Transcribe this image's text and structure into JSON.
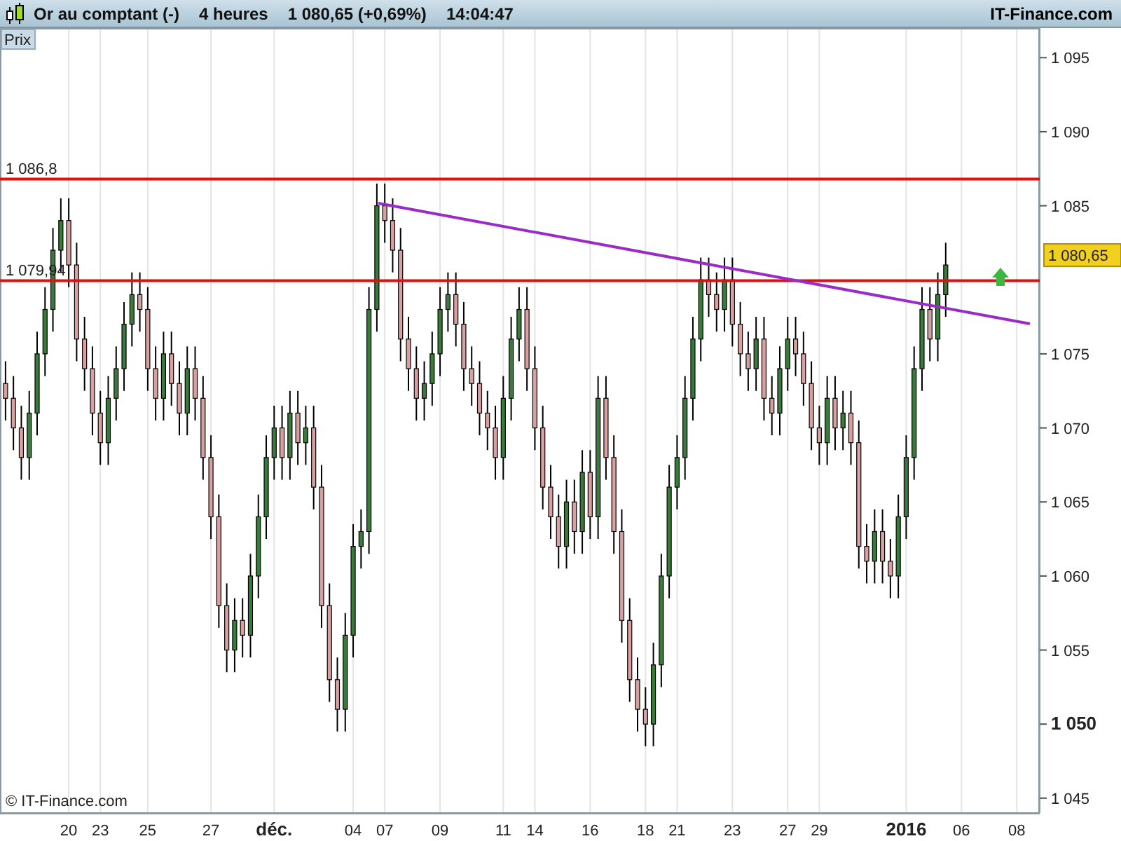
{
  "header": {
    "instrument": "Or au comptant (-)",
    "period": "4 heures",
    "quote": "1 080,65 (+0,69%)",
    "time": "14:04:47",
    "brand": "IT-Finance.com"
  },
  "panel_label": "Prix",
  "copyright": "© IT-Finance.com",
  "trend_line": {
    "color": "#9a2bc8"
  },
  "signal": {
    "kind": "up",
    "color": "#3cb83c"
  },
  "last_price": {
    "label": "1 080,65",
    "color": "#f2d020"
  },
  "chart_data": {
    "type": "candlestick",
    "ylim": [
      1044,
      1097
    ],
    "yticks": [
      {
        "value": 1045,
        "label": "1 045"
      },
      {
        "value": 1050,
        "label": "1 050"
      },
      {
        "value": 1055,
        "label": "1 055"
      },
      {
        "value": 1060,
        "label": "1 060"
      },
      {
        "value": 1065,
        "label": "1 065"
      },
      {
        "value": 1070,
        "label": "1 070"
      },
      {
        "value": 1075,
        "label": "1 075"
      },
      {
        "value": 1085,
        "label": "1 085"
      },
      {
        "value": 1090,
        "label": "1 090"
      },
      {
        "value": 1095,
        "label": "1 095"
      }
    ],
    "categories": [
      null,
      null,
      null,
      null,
      null,
      null,
      null,
      null,
      "20",
      null,
      null,
      null,
      "23",
      null,
      null,
      null,
      null,
      null,
      "25",
      null,
      null,
      null,
      null,
      null,
      null,
      null,
      "27",
      null,
      null,
      null,
      null,
      null,
      null,
      null,
      "déc.",
      null,
      null,
      null,
      null,
      null,
      null,
      null,
      null,
      null,
      "04",
      null,
      null,
      null,
      "07",
      null,
      null,
      null,
      null,
      null,
      null,
      "09",
      null,
      null,
      null,
      null,
      null,
      null,
      null,
      "11",
      null,
      null,
      null,
      "14",
      null,
      null,
      null,
      null,
      null,
      null,
      "16",
      null,
      null,
      null,
      null,
      null,
      null,
      "18",
      null,
      null,
      null,
      "21",
      null,
      null,
      null,
      null,
      null,
      null,
      "23",
      null,
      null,
      null,
      null,
      null,
      null,
      "27",
      null,
      null,
      null,
      "29",
      null,
      null,
      null,
      null,
      null,
      null,
      null,
      null,
      null,
      null,
      "2016",
      null,
      null,
      null,
      null,
      null,
      null,
      "06",
      null,
      null,
      null,
      null,
      null,
      null,
      "08",
      null,
      null
    ],
    "ref_lines": [
      {
        "axis": "y",
        "value": 1086.8,
        "label": "1 086,8",
        "color": "#e01010"
      },
      {
        "axis": "y",
        "value": 1079.94,
        "label": "1 079,94",
        "color": "#e01010"
      }
    ],
    "ohlc": [
      [
        1073,
        1074.5,
        1070.5,
        1072
      ],
      [
        1072,
        1073.5,
        1068.5,
        1070
      ],
      [
        1070,
        1071.5,
        1066.5,
        1068
      ],
      [
        1068,
        1072.5,
        1066.5,
        1071
      ],
      [
        1071,
        1076.5,
        1069.5,
        1075
      ],
      [
        1075,
        1079.5,
        1073.5,
        1078
      ],
      [
        1078,
        1083.5,
        1076.5,
        1082
      ],
      [
        1082,
        1085.5,
        1080.5,
        1084
      ],
      [
        1084,
        1085.5,
        1079.5,
        1081
      ],
      [
        1081,
        1082.5,
        1074.5,
        1076
      ],
      [
        1076,
        1077.5,
        1072.5,
        1074
      ],
      [
        1074,
        1075.5,
        1069.5,
        1071
      ],
      [
        1071,
        1072.5,
        1067.5,
        1069
      ],
      [
        1069,
        1073.5,
        1067.5,
        1072
      ],
      [
        1072,
        1075.5,
        1070.5,
        1074
      ],
      [
        1074,
        1078.5,
        1072.5,
        1077
      ],
      [
        1077,
        1080.5,
        1075.5,
        1079
      ],
      [
        1079,
        1080.5,
        1076.5,
        1078
      ],
      [
        1078,
        1079.5,
        1072.5,
        1074
      ],
      [
        1074,
        1075.5,
        1070.5,
        1072
      ],
      [
        1072,
        1076.5,
        1070.5,
        1075
      ],
      [
        1075,
        1076.5,
        1071.5,
        1073
      ],
      [
        1073,
        1074.5,
        1069.5,
        1071
      ],
      [
        1071,
        1075.5,
        1069.5,
        1074
      ],
      [
        1074,
        1075.5,
        1070.5,
        1072
      ],
      [
        1072,
        1073.5,
        1066.5,
        1068
      ],
      [
        1068,
        1069.5,
        1062.5,
        1064
      ],
      [
        1064,
        1065.5,
        1056.5,
        1058
      ],
      [
        1058,
        1059.5,
        1053.5,
        1055
      ],
      [
        1055,
        1058.5,
        1053.5,
        1057
      ],
      [
        1057,
        1058.5,
        1054.5,
        1056
      ],
      [
        1056,
        1061.5,
        1054.5,
        1060
      ],
      [
        1060,
        1065.5,
        1058.5,
        1064
      ],
      [
        1064,
        1069.5,
        1062.5,
        1068
      ],
      [
        1068,
        1071.5,
        1066.5,
        1070
      ],
      [
        1070,
        1071.5,
        1066.5,
        1068
      ],
      [
        1068,
        1072.5,
        1066.5,
        1071
      ],
      [
        1071,
        1072.5,
        1067.5,
        1069
      ],
      [
        1069,
        1071.5,
        1067.5,
        1070
      ],
      [
        1070,
        1071.5,
        1064.5,
        1066
      ],
      [
        1066,
        1067.5,
        1056.5,
        1058
      ],
      [
        1058,
        1059.5,
        1051.5,
        1053
      ],
      [
        1053,
        1054.5,
        1049.5,
        1051
      ],
      [
        1051,
        1057.5,
        1049.5,
        1056
      ],
      [
        1056,
        1063.5,
        1054.5,
        1062
      ],
      [
        1062,
        1064.5,
        1060.5,
        1063
      ],
      [
        1063,
        1079.5,
        1061.5,
        1078
      ],
      [
        1078,
        1086.5,
        1076.5,
        1085
      ],
      [
        1085,
        1086.5,
        1082.5,
        1084
      ],
      [
        1084,
        1085.5,
        1080.5,
        1082
      ],
      [
        1082,
        1083.5,
        1074.5,
        1076
      ],
      [
        1076,
        1077.5,
        1072.5,
        1074
      ],
      [
        1074,
        1075.5,
        1070.5,
        1072
      ],
      [
        1072,
        1074.5,
        1070.5,
        1073
      ],
      [
        1073,
        1076.5,
        1071.5,
        1075
      ],
      [
        1075,
        1079.5,
        1073.5,
        1078
      ],
      [
        1078,
        1080.5,
        1076.5,
        1079
      ],
      [
        1079,
        1080.5,
        1075.5,
        1077
      ],
      [
        1077,
        1078.5,
        1072.5,
        1074
      ],
      [
        1074,
        1075.5,
        1071.5,
        1073
      ],
      [
        1073,
        1074.5,
        1069.5,
        1071
      ],
      [
        1071,
        1072.5,
        1068.5,
        1070
      ],
      [
        1070,
        1071.5,
        1066.5,
        1068
      ],
      [
        1068,
        1073.5,
        1066.5,
        1072
      ],
      [
        1072,
        1077.5,
        1070.5,
        1076
      ],
      [
        1076,
        1079.5,
        1074.5,
        1078
      ],
      [
        1078,
        1079.5,
        1072.5,
        1074
      ],
      [
        1074,
        1075.5,
        1068.5,
        1070
      ],
      [
        1070,
        1071.5,
        1064.5,
        1066
      ],
      [
        1066,
        1067.5,
        1062.5,
        1064
      ],
      [
        1064,
        1065.5,
        1060.5,
        1062
      ],
      [
        1062,
        1066.5,
        1060.5,
        1065
      ],
      [
        1065,
        1066.5,
        1061.5,
        1063
      ],
      [
        1063,
        1068.5,
        1061.5,
        1067
      ],
      [
        1067,
        1068.5,
        1062.5,
        1064
      ],
      [
        1064,
        1073.5,
        1062.5,
        1072
      ],
      [
        1072,
        1073.5,
        1066.5,
        1068
      ],
      [
        1068,
        1069.5,
        1061.5,
        1063
      ],
      [
        1063,
        1064.5,
        1055.5,
        1057
      ],
      [
        1057,
        1058.5,
        1051.5,
        1053
      ],
      [
        1053,
        1054.5,
        1049.5,
        1051
      ],
      [
        1051,
        1052.5,
        1048.5,
        1050
      ],
      [
        1050,
        1055.5,
        1048.5,
        1054
      ],
      [
        1054,
        1061.5,
        1052.5,
        1060
      ],
      [
        1060,
        1067.5,
        1058.5,
        1066
      ],
      [
        1066,
        1069.5,
        1064.5,
        1068
      ],
      [
        1068,
        1073.5,
        1066.5,
        1072
      ],
      [
        1072,
        1077.5,
        1070.5,
        1076
      ],
      [
        1076,
        1081.5,
        1074.5,
        1080
      ],
      [
        1080,
        1081.5,
        1077.5,
        1079
      ],
      [
        1079,
        1080.5,
        1076.5,
        1078
      ],
      [
        1078,
        1081.5,
        1076.5,
        1080
      ],
      [
        1080,
        1081.5,
        1075.5,
        1077
      ],
      [
        1077,
        1078.5,
        1073.5,
        1075
      ],
      [
        1075,
        1076.5,
        1072.5,
        1074
      ],
      [
        1074,
        1077.5,
        1072.5,
        1076
      ],
      [
        1076,
        1077.5,
        1070.5,
        1072
      ],
      [
        1072,
        1073.5,
        1069.5,
        1071
      ],
      [
        1071,
        1075.5,
        1069.5,
        1074
      ],
      [
        1074,
        1077.5,
        1072.5,
        1076
      ],
      [
        1076,
        1077.5,
        1073.5,
        1075
      ],
      [
        1075,
        1076.5,
        1071.5,
        1073
      ],
      [
        1073,
        1074.5,
        1068.5,
        1070
      ],
      [
        1070,
        1071.5,
        1067.5,
        1069
      ],
      [
        1069,
        1073.5,
        1067.5,
        1072
      ],
      [
        1072,
        1073.5,
        1068.5,
        1070
      ],
      [
        1070,
        1072.5,
        1068.5,
        1071
      ],
      [
        1071,
        1072.5,
        1067.5,
        1069
      ],
      [
        1069,
        1070.5,
        1060.5,
        1062
      ],
      [
        1062,
        1063.5,
        1059.5,
        1061
      ],
      [
        1061,
        1064.5,
        1059.5,
        1063
      ],
      [
        1063,
        1064.5,
        1059.5,
        1061
      ],
      [
        1061,
        1062.5,
        1058.5,
        1060
      ],
      [
        1060,
        1065.5,
        1058.5,
        1064
      ],
      [
        1064,
        1069.5,
        1062.5,
        1068
      ],
      [
        1068,
        1075.5,
        1066.5,
        1074
      ],
      [
        1074,
        1079.5,
        1072.5,
        1078
      ],
      [
        1078,
        1079.5,
        1074.5,
        1076
      ],
      [
        1076,
        1080.5,
        1074.5,
        1079
      ],
      [
        1079,
        1082.5,
        1077.5,
        1081
      ],
      null,
      null,
      null,
      null,
      null,
      null,
      null,
      null,
      null,
      null,
      null
    ]
  }
}
